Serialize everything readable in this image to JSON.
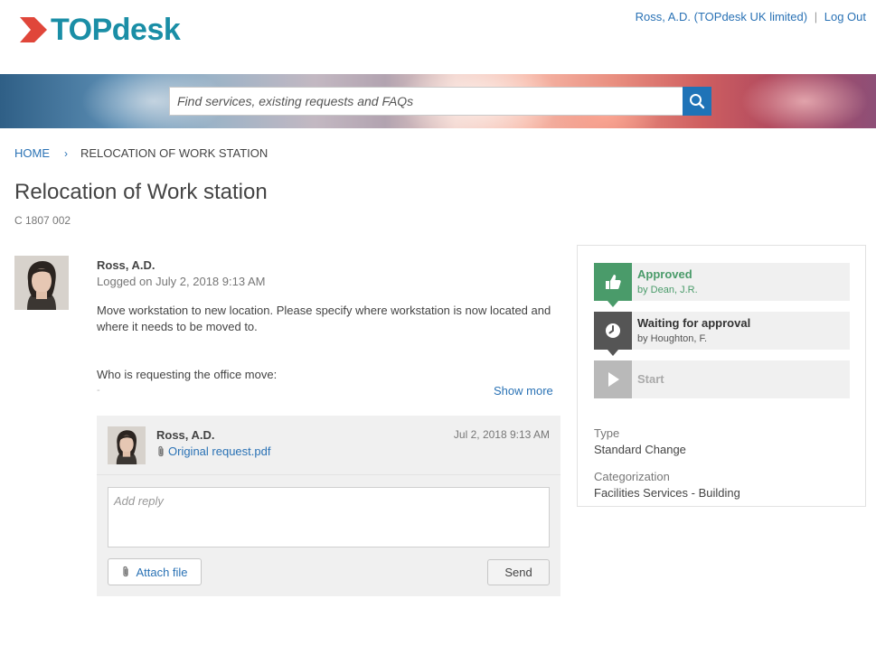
{
  "header": {
    "brand": "TOPdesk",
    "user": "Ross, A.D. (TOPdesk UK limited)",
    "separator": "|",
    "logout": "Log Out"
  },
  "search": {
    "placeholder": "Find services, existing requests and FAQs",
    "icon": "search-icon"
  },
  "breadcrumb": {
    "home": "HOME",
    "current": "RELOCATION OF WORK STATION"
  },
  "page": {
    "title": "Relocation of Work station",
    "ticket_id": "C 1807 002"
  },
  "request": {
    "author": "Ross, A.D.",
    "logged": "Logged on July 2, 2018 9:13 AM",
    "body": "Move workstation to new location. Please specify where workstation is now located and where it needs to be moved to.",
    "question": "Who is requesting the office move:",
    "answer": "-",
    "show_more": "Show more"
  },
  "thread": {
    "message": {
      "author": "Ross, A.D.",
      "date": "Jul 2, 2018 9:13 AM",
      "attachment": "Original request.pdf"
    },
    "reply_placeholder": "Add reply",
    "attach_label": "Attach file",
    "send_label": "Send"
  },
  "status": {
    "steps": [
      {
        "title": "Approved",
        "sub": "by Dean, J.R.",
        "icon": "thumbs-up-icon",
        "color": "#4a9b6a"
      },
      {
        "title": "Waiting for approval",
        "sub": "by Houghton, F.",
        "icon": "clock-icon",
        "color": "#555555"
      },
      {
        "title": "Start",
        "sub": "",
        "icon": "play-icon",
        "color": "#b9b9b9"
      }
    ],
    "type_label": "Type",
    "type_value": "Standard Change",
    "category_label": "Categorization",
    "category_value": "Facilities Services - Building"
  },
  "colors": {
    "brand": "#1a8ea6",
    "logo_mark": "#e0463a",
    "link": "#2a72b5",
    "search_button": "#1f73b7",
    "approved": "#4a9b6a"
  }
}
